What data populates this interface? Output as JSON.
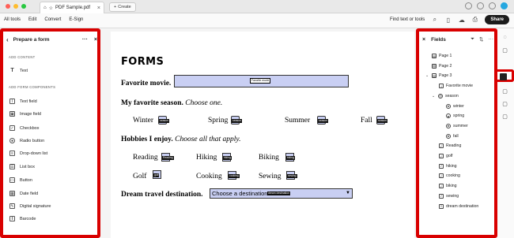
{
  "titlebar": {
    "tab_title": "PDF Sample.pdf",
    "new_tab_label": "Create"
  },
  "menubar": {
    "items": [
      "All tools",
      "Edit",
      "Convert",
      "E-Sign"
    ],
    "find_label": "Find text or tools",
    "share_label": "Share"
  },
  "left_panel": {
    "title": "Prepare a form",
    "section_content": "ADD CONTENT",
    "content_items": [
      {
        "label": "Text",
        "icon": "text-tool-icon"
      }
    ],
    "section_components": "ADD FORM COMPONENTS",
    "component_items": [
      {
        "label": "Text field",
        "icon": "text-field-icon"
      },
      {
        "label": "Image field",
        "icon": "image-field-icon"
      },
      {
        "label": "Checkbox",
        "icon": "checkbox-icon"
      },
      {
        "label": "Radio button",
        "icon": "radio-button-icon"
      },
      {
        "label": "Drop-down list",
        "icon": "dropdown-list-icon"
      },
      {
        "label": "List box",
        "icon": "list-box-icon"
      },
      {
        "label": "Button",
        "icon": "button-icon"
      },
      {
        "label": "Date field",
        "icon": "date-field-icon"
      },
      {
        "label": "Digital signature",
        "icon": "digital-signature-icon"
      },
      {
        "label": "Barcode",
        "icon": "barcode-icon"
      }
    ]
  },
  "document": {
    "title": "FORMS",
    "q_movie": "Favorite movie.",
    "movie_tag": "Favorite movie",
    "q_season": "My favorite season.",
    "q_season_hint": "Choose one.",
    "seasons": [
      "Winter",
      "Spring",
      "Summer",
      "Fall"
    ],
    "season_tags": [
      "season",
      "season",
      "season",
      "season"
    ],
    "q_hobbies": "Hobbies I enjoy.",
    "q_hobbies_hint": "Choose all that apply.",
    "hobbies": [
      "Reading",
      "Hiking",
      "Biking",
      "Golf",
      "Cooking",
      "Sewing"
    ],
    "hobby_tags": [
      "Reading",
      "hiking",
      "biking",
      "golf",
      "cooking",
      "sewing"
    ],
    "q_travel": "Dream travel destination.",
    "travel_value": "Choose a destination",
    "travel_tag": "dream destination"
  },
  "right_panel": {
    "title": "Fields",
    "items": [
      {
        "label": "Page 1",
        "indent": 1,
        "icon": "page-icon"
      },
      {
        "label": "Page 2",
        "indent": 1,
        "icon": "page-icon"
      },
      {
        "label": "Page 3",
        "indent": 0,
        "icon": "page-icon",
        "expanded": true
      },
      {
        "label": "Favorite movie",
        "indent": 2,
        "icon": "text-field-icon"
      },
      {
        "label": "season",
        "indent": 1,
        "icon": "radio-group-icon",
        "expanded": true
      },
      {
        "label": "winter",
        "indent": 3,
        "icon": "radio-button-icon"
      },
      {
        "label": "spring",
        "indent": 3,
        "icon": "radio-button-icon"
      },
      {
        "label": "summer",
        "indent": 3,
        "icon": "radio-button-icon"
      },
      {
        "label": "fall",
        "indent": 3,
        "icon": "radio-button-icon"
      },
      {
        "label": "Reading",
        "indent": 2,
        "icon": "checkbox-icon"
      },
      {
        "label": "golf",
        "indent": 2,
        "icon": "checkbox-icon"
      },
      {
        "label": "hiking",
        "indent": 2,
        "icon": "checkbox-icon"
      },
      {
        "label": "cooking",
        "indent": 2,
        "icon": "checkbox-icon"
      },
      {
        "label": "biking",
        "indent": 2,
        "icon": "checkbox-icon"
      },
      {
        "label": "sewing",
        "indent": 2,
        "icon": "checkbox-icon"
      },
      {
        "label": "dream destination",
        "indent": 2,
        "icon": "dropdown-list-icon"
      }
    ]
  },
  "colors": {
    "highlight_border": "#d90000",
    "form_field_fill": "#c9cff3",
    "share_button": "#1b1b1b"
  }
}
